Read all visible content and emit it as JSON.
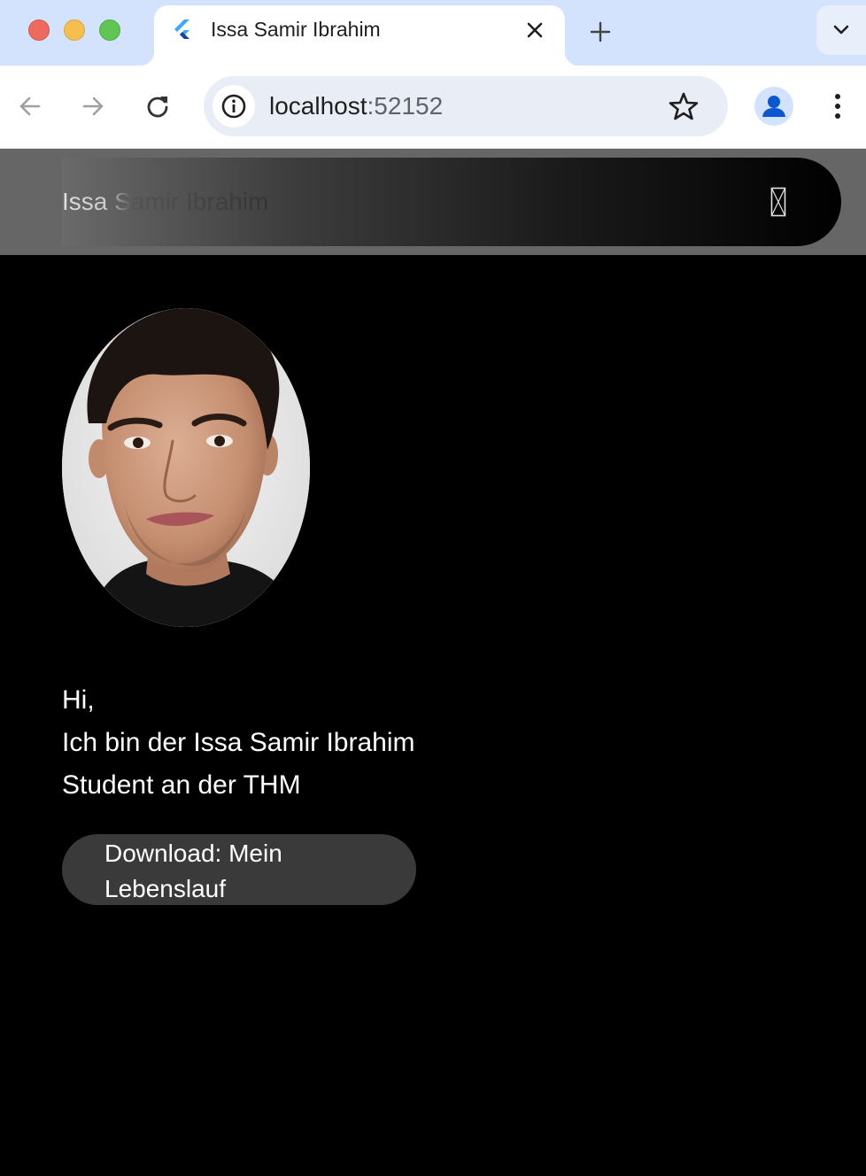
{
  "browser": {
    "tab": {
      "title": "Issa Samir Ibrahim",
      "favicon": "flutter-icon"
    },
    "address": {
      "host": "localhost",
      "port": ":52152"
    },
    "icons": {
      "back": "arrow-left-icon",
      "forward": "arrow-right-icon",
      "reload": "reload-icon",
      "site_info": "info-icon",
      "bookmark": "star-icon",
      "profile": "person-icon",
      "menu": "kebab-icon",
      "new_tab": "plus-icon",
      "tab_close": "close-icon",
      "tab_search": "chevron-down-icon"
    }
  },
  "appbar": {
    "title": "Issa Samir Ibrahim",
    "menu_icon": "missing-glyph-icon"
  },
  "hero": {
    "photo": "profile-photo",
    "line1": "Hi,",
    "line2": "Ich bin der Issa Samir Ibrahim",
    "line3": "Student an der THM",
    "download_label": "Download: Mein Lebenslauf"
  },
  "colors": {
    "tabstrip": "#d3e3fd",
    "page_bg": "#000000",
    "appbar_bg": "#666666",
    "button_bg": "#3a3a3a",
    "text": "#ffffff"
  }
}
